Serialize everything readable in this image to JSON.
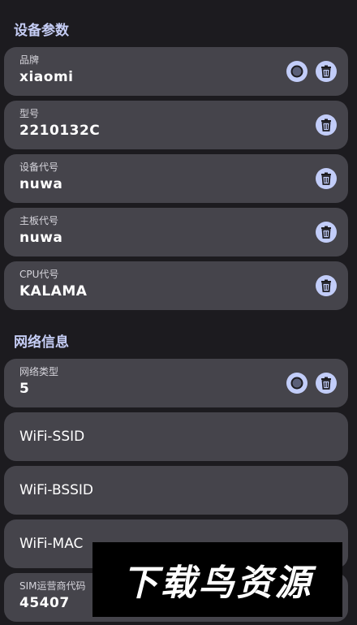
{
  "sections": {
    "device": {
      "title": "设备参数"
    },
    "network": {
      "title": "网络信息"
    }
  },
  "device_fields": [
    {
      "label": "品牌",
      "value": "xiaomi",
      "icons": [
        "circle-icon",
        "trash-icon"
      ]
    },
    {
      "label": "型号",
      "value": "2210132C",
      "icons": [
        "trash-icon"
      ]
    },
    {
      "label": "设备代号",
      "value": "nuwa",
      "icons": [
        "trash-icon"
      ]
    },
    {
      "label": "主板代号",
      "value": "nuwa",
      "icons": [
        "trash-icon"
      ]
    },
    {
      "label": "CPU代号",
      "value": "KALAMA",
      "icons": [
        "trash-icon"
      ]
    }
  ],
  "network_fields": [
    {
      "label": "网络类型",
      "value": "5",
      "icons": [
        "circle-icon",
        "trash-icon"
      ]
    },
    {
      "label": "WiFi-SSID"
    },
    {
      "label": "WiFi-BSSID"
    },
    {
      "label": "WiFi-MAC"
    },
    {
      "label": "SIM运营商代码",
      "value": "45407"
    }
  ],
  "watermark": {
    "text": "下载鸟资源"
  },
  "colors": {
    "background": "#1c1b1f",
    "card": "#45444b",
    "section_title": "#c5cdf5",
    "icon_button": "#c2cdf9",
    "icon_glyph": "#1c1b1f"
  }
}
